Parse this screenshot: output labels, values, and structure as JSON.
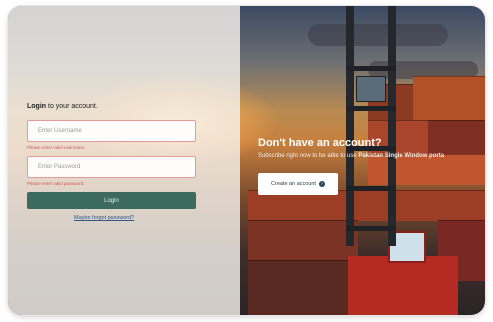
{
  "login": {
    "title_bold": "Login",
    "title_rest": " to your account.",
    "username_placeholder": "Enter Username",
    "username_error": "Please enter valid username.",
    "password_placeholder": "Enter Password",
    "password_error": "Please enter valid password.",
    "login_label": "Login",
    "forgot_label": "Maybe forgot password?"
  },
  "signup": {
    "title": "Don't have an account?",
    "subtitle_prefix": "Subscribe right now to be able to use ",
    "subtitle_brand": "Pakistan Single Window porta",
    "create_label": "Create an account",
    "create_icon": "arrow-right-circle-icon"
  },
  "colors": {
    "login_button": "#3c6a5c",
    "error_text": "#d05a5a",
    "field_border_error": "#e59a9a"
  }
}
